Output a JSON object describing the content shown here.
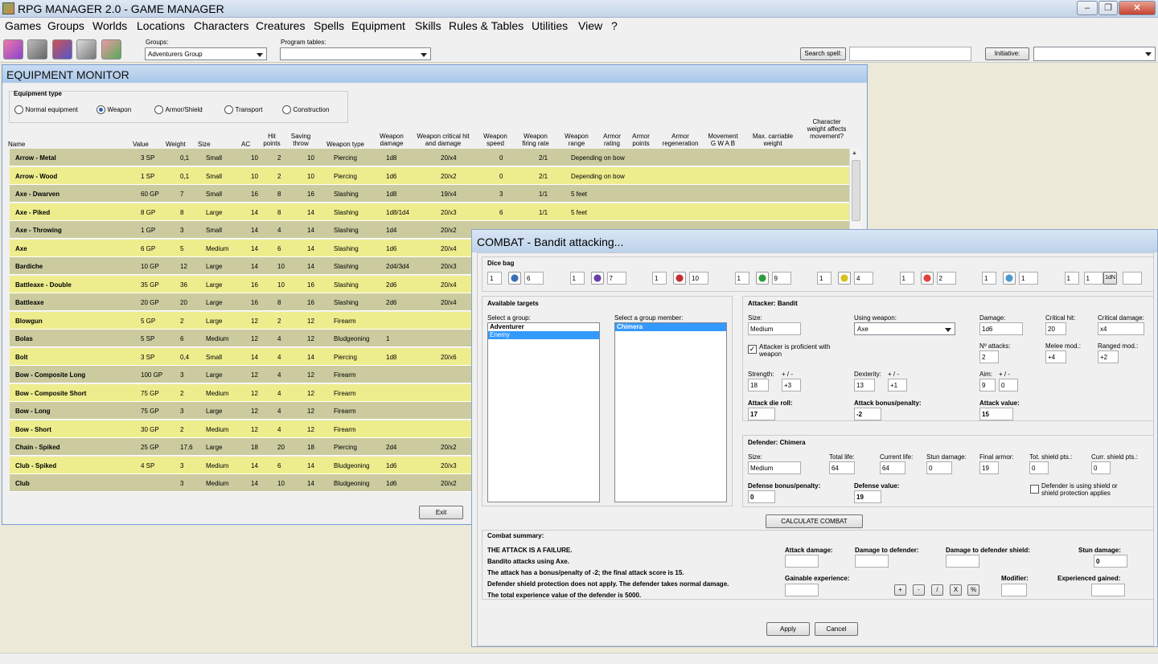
{
  "window": {
    "title": "RPG MANAGER 2.0 - GAME MANAGER",
    "minimize": "–",
    "restore": "❐",
    "close": "✕"
  },
  "menu": [
    "Games",
    "Groups",
    "Worlds",
    "Locations",
    "Characters",
    "Creatures",
    "Spells",
    "Equipment",
    "Skills",
    "Rules & Tables",
    "Utilities",
    "View",
    "?"
  ],
  "toolbar": {
    "groups_label": "Groups:",
    "groups_value": "Adventurers Group",
    "program_tables_label": "Program tables:",
    "program_tables_value": "",
    "search_spell_label": "Search spell:",
    "search_spell_value": "",
    "initiative_label": "Initiative:",
    "initiative_value": ""
  },
  "equipment_monitor": {
    "title": "EQUIPMENT MONITOR",
    "type_group_label": "Equipment type",
    "types": [
      "Normal equipment",
      "Weapon",
      "Armor/Shield",
      "Transport",
      "Construction"
    ],
    "selected_type": "Weapon",
    "columns": [
      "Name",
      "Value",
      "Weight",
      "Size",
      "AC",
      "Hit points",
      "Saving throw",
      "Weapon type",
      "Weapon damage",
      "Weapon critical hit and damage",
      "Weapon speed",
      "Weapon firing rate",
      "Weapon range",
      "Armor rating",
      "Armor points",
      "Armor regeneration",
      "Movement G W A B",
      "Max. carriable weight",
      "Character weight affects movement?"
    ],
    "rows": [
      [
        "Arrow - Metal",
        "3 SP",
        "0,1",
        "Small",
        "10",
        "2",
        "10",
        "Piercing",
        "1d8",
        "20/x4",
        "0",
        "2/1",
        "Depending on bow"
      ],
      [
        "Arrow - Wood",
        "1 SP",
        "0,1",
        "Small",
        "10",
        "2",
        "10",
        "Piercing",
        "1d6",
        "20/x2",
        "0",
        "2/1",
        "Depending on bow"
      ],
      [
        "Axe - Dwarven",
        "60 GP",
        "7",
        "Small",
        "16",
        "8",
        "16",
        "Slashing",
        "1d8",
        "19/x4",
        "3",
        "1/1",
        "5 feet"
      ],
      [
        "Axe - Piked",
        "8 GP",
        "8",
        "Large",
        "14",
        "8",
        "14",
        "Slashing",
        "1d8/1d4",
        "20/x3",
        "6",
        "1/1",
        "5 feet"
      ],
      [
        "Axe - Throwing",
        "1 GP",
        "3",
        "Small",
        "14",
        "4",
        "14",
        "Slashing",
        "1d4",
        "20/x2",
        "",
        "",
        ""
      ],
      [
        "Axe",
        "6 GP",
        "5",
        "Medium",
        "14",
        "6",
        "14",
        "Slashing",
        "1d6",
        "20/x4",
        "",
        "",
        ""
      ],
      [
        "Bardiche",
        "10 GP",
        "12",
        "Large",
        "14",
        "10",
        "14",
        "Slashing",
        "2d4/3d4",
        "20/x3",
        "",
        "",
        ""
      ],
      [
        "Battleaxe - Double",
        "35 GP",
        "36",
        "Large",
        "16",
        "10",
        "16",
        "Slashing",
        "2d6",
        "20/x4",
        "",
        "",
        ""
      ],
      [
        "Battleaxe",
        "20 GP",
        "20",
        "Large",
        "16",
        "8",
        "16",
        "Slashing",
        "2d6",
        "20/x4",
        "",
        "",
        ""
      ],
      [
        "Blowgun",
        "5 GP",
        "2",
        "Large",
        "12",
        "2",
        "12",
        "Firearm",
        "",
        "",
        "",
        "",
        ""
      ],
      [
        "Bolas",
        "5 SP",
        "6",
        "Medium",
        "12",
        "4",
        "12",
        "Bludgeoning",
        "1",
        "",
        "",
        "",
        ""
      ],
      [
        "Bolt",
        "3 SP",
        "0,4",
        "Small",
        "14",
        "4",
        "14",
        "Piercing",
        "1d8",
        "20/x6",
        "",
        "",
        ""
      ],
      [
        "Bow - Composite Long",
        "100 GP",
        "3",
        "Large",
        "12",
        "4",
        "12",
        "Firearm",
        "",
        "",
        "",
        "",
        ""
      ],
      [
        "Bow - Composite Short",
        "75 GP",
        "2",
        "Medium",
        "12",
        "4",
        "12",
        "Firearm",
        "",
        "",
        "",
        "",
        ""
      ],
      [
        "Bow - Long",
        "75 GP",
        "3",
        "Large",
        "12",
        "4",
        "12",
        "Firearm",
        "",
        "",
        "",
        "",
        ""
      ],
      [
        "Bow - Short",
        "30 GP",
        "2",
        "Medium",
        "12",
        "4",
        "12",
        "Firearm",
        "",
        "",
        "",
        "",
        ""
      ],
      [
        "Chain - Spiked",
        "25 GP",
        "17,6",
        "Large",
        "18",
        "20",
        "18",
        "Piercing",
        "2d4",
        "20/x2",
        "",
        "",
        ""
      ],
      [
        "Club - Spiked",
        "4 SP",
        "3",
        "Medium",
        "14",
        "6",
        "14",
        "Bludgeoning",
        "1d6",
        "20/x3",
        "",
        "",
        ""
      ],
      [
        "Club",
        "",
        "3",
        "Medium",
        "14",
        "10",
        "14",
        "Bludgeoning",
        "1d6",
        "20/x2",
        "",
        "",
        ""
      ]
    ],
    "exit_label": "Exit"
  },
  "combat": {
    "title": "COMBAT - Bandit    attacking...",
    "dice_bag_label": "Dice bag",
    "dice": [
      {
        "count": "1",
        "value": "6"
      },
      {
        "count": "1",
        "value": "7"
      },
      {
        "count": "1",
        "value": "10"
      },
      {
        "count": "1",
        "value": "9"
      },
      {
        "count": "1",
        "value": "4"
      },
      {
        "count": "1",
        "value": "2"
      },
      {
        "count": "1",
        "value": "1"
      },
      {
        "count": "1",
        "value": "1"
      }
    ],
    "custom_die_label": "1dN",
    "custom_die_value": "",
    "targets": {
      "label": "Available targets",
      "group_label": "Select a group:",
      "groups": [
        "Adventurer",
        "Enemy"
      ],
      "selected_group": "Enemy",
      "member_label": "Select a group member:",
      "members": [
        "Chimera"
      ]
    },
    "attacker": {
      "title": "Attacker: Bandit",
      "size_label": "Size:",
      "size": "Medium",
      "weapon_label": "Using weapon:",
      "weapon": "Axe",
      "damage_label": "Damage:",
      "damage": "1d6",
      "crit_hit_label": "Critical hit:",
      "crit_hit": "20",
      "crit_dmg_label": "Critical damage:",
      "crit_dmg": "x4",
      "proficient_label": "Attacker is proficient with weapon",
      "proficient": "✓",
      "attacks_label": "Nº attacks:",
      "attacks": "2",
      "melee_label": "Melee mod.:",
      "melee": "+4",
      "ranged_label": "Ranged mod.:",
      "ranged": "+2",
      "str_label": "Strength:",
      "str": "18",
      "str_mod": "+3",
      "dex_label": "Dexterity:",
      "dex": "13",
      "dex_mod": "+1",
      "aim_label": "Aim:",
      "aim": "9",
      "aim_mod": "0",
      "pm_label": "+ / -",
      "roll_label": "Attack die roll:",
      "roll": "17",
      "bonus_label": "Attack bonus/penalty:",
      "bonus": "-2",
      "value_label": "Attack value:",
      "value": "15"
    },
    "defender": {
      "title": "Defender: Chimera",
      "size_label": "Size:",
      "size": "Medium",
      "total_life_label": "Total life:",
      "total_life": "64",
      "current_life_label": "Current life:",
      "current_life": "64",
      "stun_label": "Stun damage:",
      "stun": "0",
      "armor_label": "Final armor:",
      "armor": "19",
      "tot_shield_label": "Tot. shield pts.:",
      "tot_shield": "0",
      "curr_shield_label": "Curr. shield pts.:",
      "curr_shield": "0",
      "def_bonus_label": "Defense bonus/penalty:",
      "def_bonus": "0",
      "def_value_label": "Defense value:",
      "def_value": "19",
      "shield_check_label": "Defender is using shield or shield protection applies"
    },
    "calc_label": "CALCULATE COMBAT RESULTS",
    "summary": {
      "label": "Combat summary:",
      "lines": [
        "THE ATTACK IS A FAILURE.",
        "Bandito attacks using Axe.",
        "The attack has a bonus/penalty of -2; the final attack score is 15.",
        "Defender shield protection does not apply. The defender takes normal damage.",
        "The total experience value of the defender is 5000."
      ],
      "attack_damage_label": "Attack damage:",
      "dmg_defender_label": "Damage to defender:",
      "dmg_shield_label": "Damage to defender shield:",
      "stun_label": "Stun damage:",
      "stun": "0",
      "gain_exp_label": "Gainable experience:",
      "ops": [
        "+",
        "-",
        "/",
        "X",
        "%"
      ],
      "modifier_label": "Modifier:",
      "exp_gained_label": "Experienced gained:"
    },
    "apply_label": "Apply",
    "cancel_label": "Cancel"
  },
  "colors": {
    "row_yellow": "#eeed8e",
    "row_tan": "#cbcb9f",
    "selection": "#3399ff"
  }
}
